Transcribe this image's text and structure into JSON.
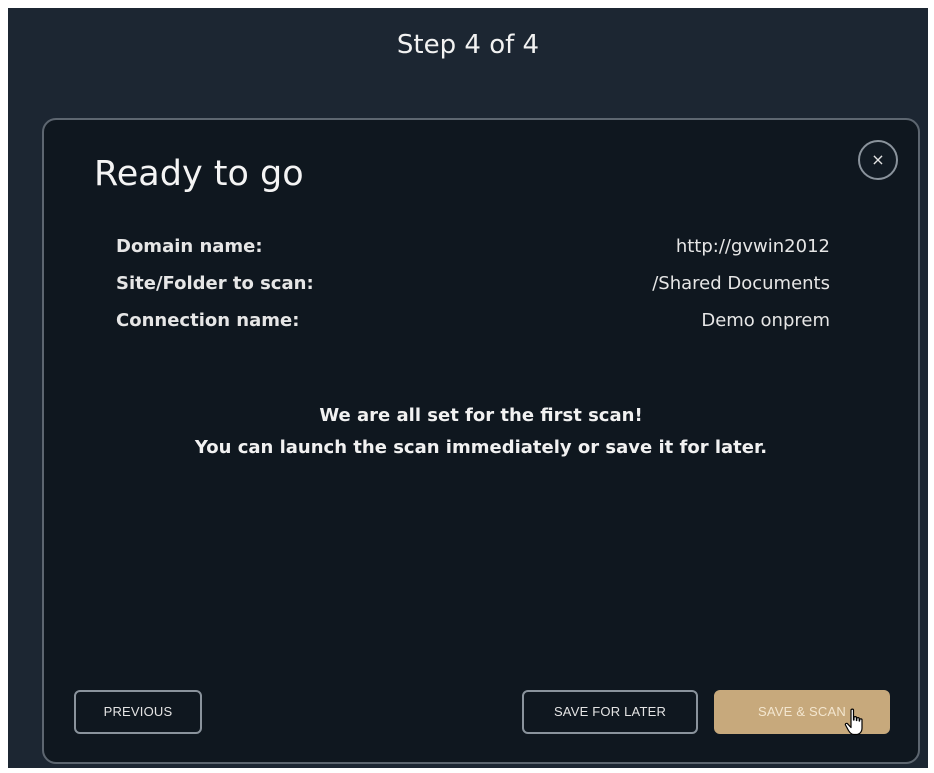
{
  "header": {
    "step_title": "Step 4 of  4"
  },
  "modal": {
    "title": "Ready to go",
    "close_label": "×",
    "summary": [
      {
        "label": "Domain name:",
        "value": "http://gvwin2012"
      },
      {
        "label": "Site/Folder to scan:",
        "value": "/Shared Documents"
      },
      {
        "label": "Connection name:",
        "value": "Demo onprem"
      }
    ],
    "message_line1": "We are all set for the first scan!",
    "message_line2": "You can launch the scan immediately or save it for later.",
    "buttons": {
      "previous": "PREVIOUS",
      "save_for_later": "SAVE FOR LATER",
      "save_and_scan": "SAVE & SCAN"
    }
  },
  "colors": {
    "page_background": "#1c2632",
    "modal_background": "#0f171f",
    "accent": "#c7a97c"
  },
  "icons": {
    "close": "close-icon",
    "cursor": "hand-pointer-icon"
  }
}
